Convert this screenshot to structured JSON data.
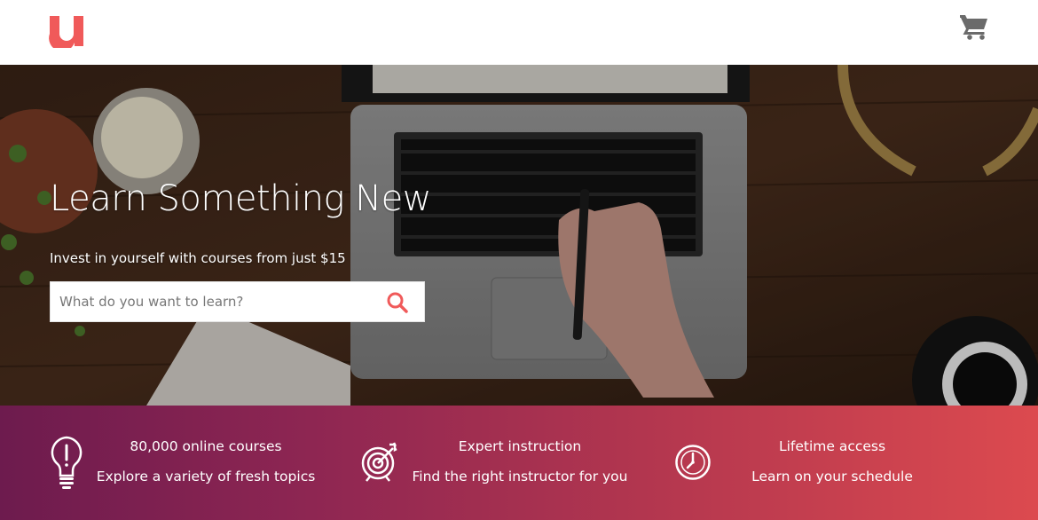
{
  "header": {
    "logo_letter": "u",
    "logo_color": "#f05a5a",
    "cart_icon": "shopping-cart-icon"
  },
  "hero": {
    "title": "Learn Something New",
    "subtitle": "Invest in yourself with courses from just $15",
    "search": {
      "placeholder": "What do you want to learn?",
      "value": "",
      "icon": "search-icon",
      "icon_color": "#f05a5a"
    }
  },
  "features": [
    {
      "icon": "lightbulb-icon",
      "title": "80,000 online courses",
      "description": "Explore a variety of fresh topics"
    },
    {
      "icon": "target-icon",
      "title": "Expert instruction",
      "description": "Find the right instructor for you"
    },
    {
      "icon": "clock-icon",
      "title": "Lifetime access",
      "description": "Learn on your schedule"
    }
  ],
  "colors": {
    "band_start": "#6d1b4e",
    "band_end": "#dc4a4f",
    "accent": "#f05a5a"
  }
}
